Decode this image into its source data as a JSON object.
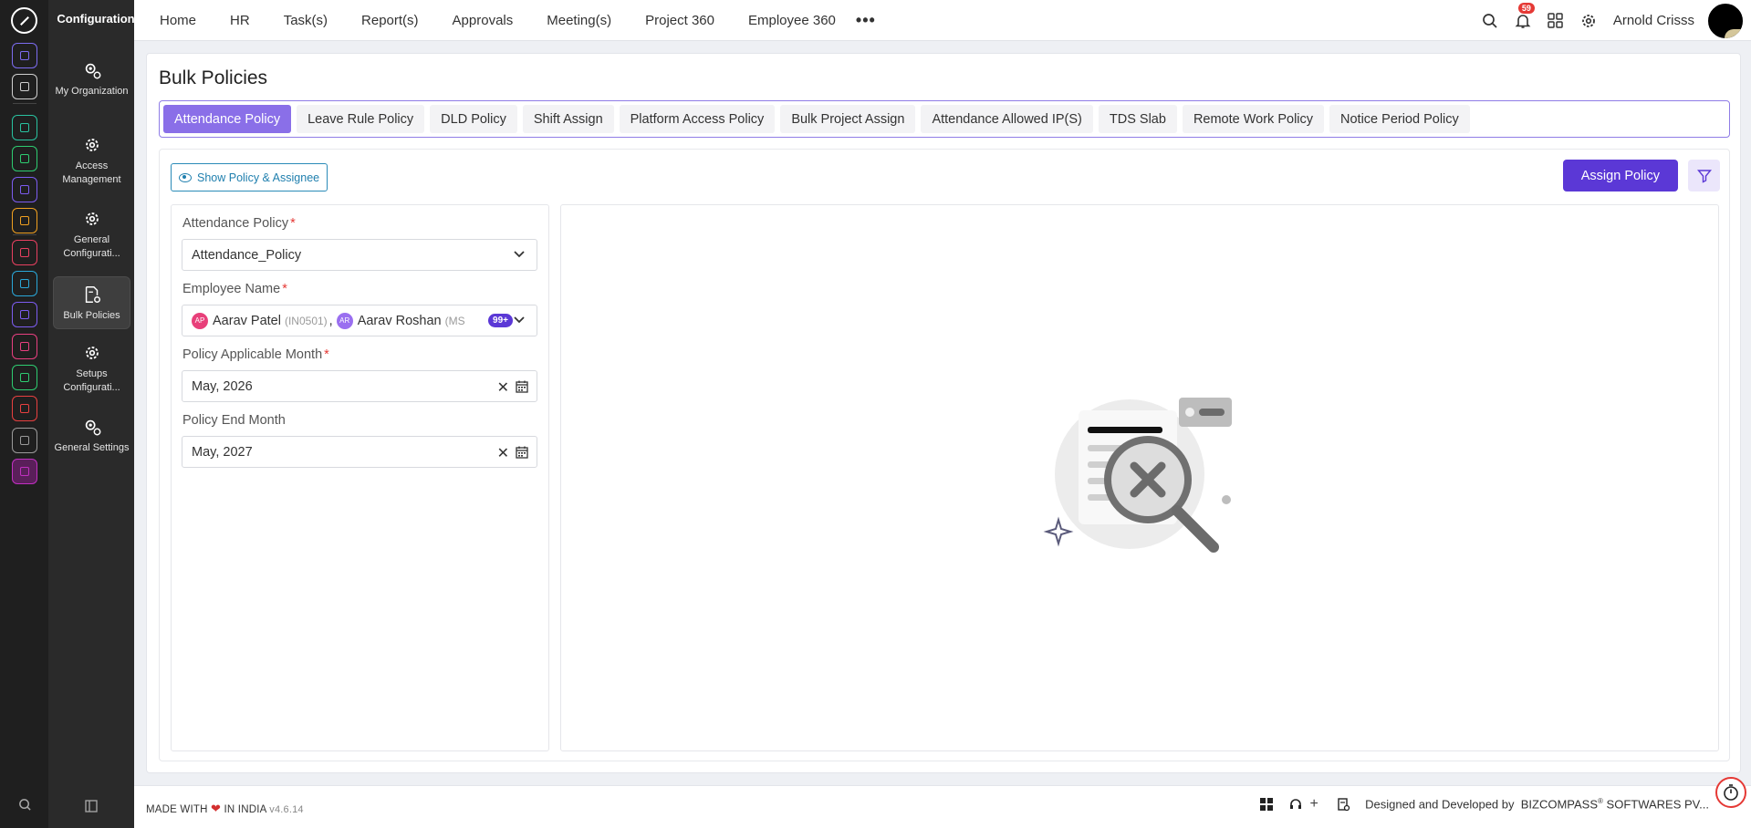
{
  "app": {
    "section_title": "Configuration"
  },
  "rail": {
    "colors": [
      "#7c6cf0",
      "#cfcfcf",
      "#29c2a0",
      "#2ecc71",
      "#7c5cf0",
      "#f0a020",
      "#e84060",
      "#2aa7d8",
      "#7c5cf0",
      "#e84080",
      "#2ecc71",
      "#e84040",
      "#9a9a9a",
      "#c030c0"
    ]
  },
  "sidebar": {
    "items": [
      {
        "label": "My Organization",
        "icon": "org-gear-icon"
      },
      {
        "label": "Access Management",
        "icon": "gear-icon"
      },
      {
        "label": "General Configurati...",
        "icon": "gear-icon"
      },
      {
        "label": "Bulk Policies",
        "icon": "document-gear-icon"
      },
      {
        "label": "Setups Configurati...",
        "icon": "gear-icon"
      },
      {
        "label": "General Settings",
        "icon": "org-gear-icon"
      }
    ]
  },
  "topnav": {
    "links": [
      "Home",
      "HR",
      "Task(s)",
      "Report(s)",
      "Approvals",
      "Meeting(s)",
      "Project 360",
      "Employee 360"
    ],
    "more": "•••",
    "notifications_count": "59",
    "user_name": "Arnold Crisss"
  },
  "page": {
    "title": "Bulk Policies",
    "tabs": [
      "Attendance Policy",
      "Leave Rule Policy",
      "DLD Policy",
      "Shift Assign",
      "Platform Access Policy",
      "Bulk Project Assign",
      "Attendance Allowed IP(S)",
      "TDS Slab",
      "Remote Work Policy",
      "Notice Period Policy"
    ],
    "active_tab": "Attendance Policy",
    "show_button": "Show Policy & Assignee",
    "assign_button": "Assign Policy"
  },
  "form": {
    "attendance_policy": {
      "label": "Attendance Policy",
      "required": "*",
      "value": "Attendance_Policy"
    },
    "employee_name": {
      "label": "Employee Name",
      "required": "*",
      "chips": [
        {
          "initials": "AP",
          "name": "Aarav Patel",
          "code": "(IN0501)",
          "color": "#e8407a"
        },
        {
          "initials": "AR",
          "name": "Aarav Roshan",
          "code": "(MS",
          "color": "#9a6ff0"
        }
      ],
      "separator": ",",
      "more_count": "99+"
    },
    "applicable_month": {
      "label": "Policy Applicable Month",
      "required": "*",
      "value": "May, 2026"
    },
    "end_month": {
      "label": "Policy End Month",
      "value": "May, 2027"
    }
  },
  "footer": {
    "made_with": "MADE WITH",
    "in_india": "IN INDIA",
    "version": "v4.6.14",
    "credit_prefix": "Designed and Developed by",
    "company": "BIZCOMPASS",
    "reg": "®",
    "company_suffix": "SOFTWARES PV..."
  }
}
